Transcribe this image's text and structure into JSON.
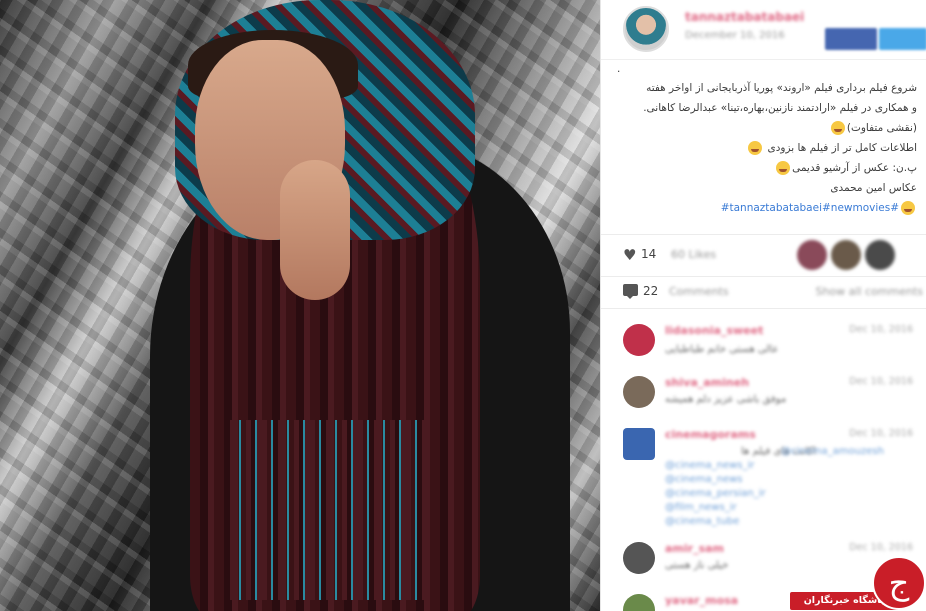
{
  "post": {
    "username": "tannaztabatabaei",
    "date": "December 10, 2016",
    "caption_dot": ".",
    "caption_lines": [
      "شروع فیلم برداری فیلم «اروند» پوریا آذربایجانی از اواخر هفته",
      "و همکاری در فیلم «ارادتمند نازنین،بهاره،تینا» عبدالرضا کاهانی.",
      "(نقشی متفاوت)",
      "اطلاعات کامل تر از فیلم ها بزودی",
      "پ.ن: عکس از آرشیو قدیمی",
      "عکاس امین محمدی"
    ],
    "hashtags": "#tannaztabatabaei#newmovies#"
  },
  "stats": {
    "like_count": "14",
    "likes_label": "60 Likes",
    "comment_count": "22",
    "comments_label": "Comments",
    "show_all_label": "Show all comments"
  },
  "comments": [
    {
      "name": "lidasonia_sweet",
      "time": "Dec 10, 2016",
      "text": "عالی هستی خانم طباطبایی",
      "avatar_color": "#c0304a"
    },
    {
      "name": "shiva_amineh",
      "time": "Dec 10, 2016",
      "text": "موفق باشی عزیز دلم همیشه",
      "avatar_color": "#7a6a5a"
    },
    {
      "name": "cinemagorams",
      "time": "Dec 10, 2016",
      "text": "اکانت های فیلم ها",
      "links": [
        "@cinema_amouzesh",
        "@cinema_news_ir",
        "@cinema_news",
        "@cinema_persian_ir",
        "@film_news_ir",
        "@cinema_tube"
      ],
      "avatar_color": "#3a66b0"
    },
    {
      "name": "amir_sam",
      "time": "Dec 10, 2016",
      "text": "خیلی ناز هستی",
      "avatar_color": "#555555"
    },
    {
      "name": "yavar_mosa",
      "time": "Dec 10, 2016",
      "text": "",
      "avatar_color": "#6a8a4a"
    }
  ],
  "watermark": {
    "logo_glyph": "ج",
    "label": "باشگاه خبرنگاران"
  },
  "colors": {
    "username": "#e06a86",
    "hashtag": "#3a7bd5",
    "brand_red": "#c91e28"
  }
}
